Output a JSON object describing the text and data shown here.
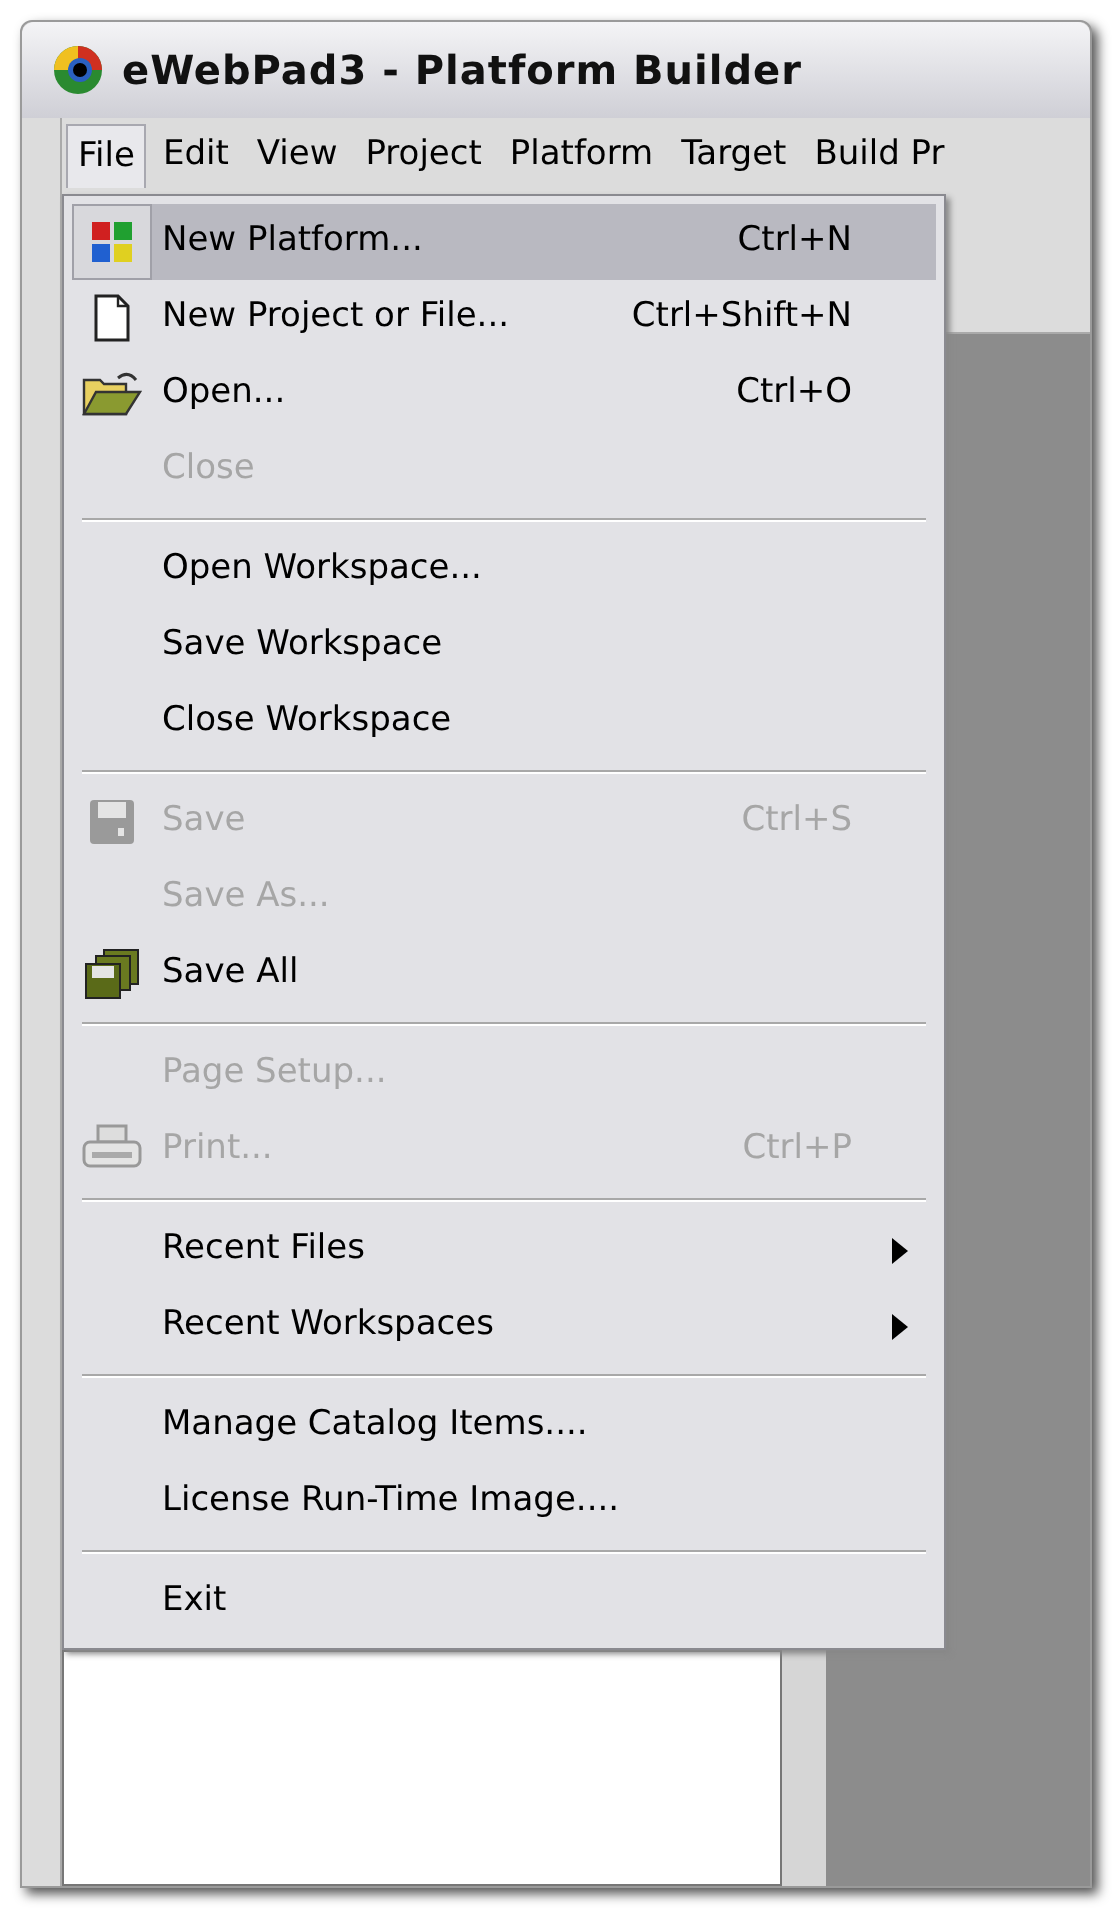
{
  "window": {
    "title": "eWebPad3 - Platform Builder"
  },
  "menu_bar": [
    {
      "label": "File",
      "selected": true
    },
    {
      "label": "Edit",
      "selected": false
    },
    {
      "label": "View",
      "selected": false
    },
    {
      "label": "Project",
      "selected": false
    },
    {
      "label": "Platform",
      "selected": false
    },
    {
      "label": "Target",
      "selected": false
    },
    {
      "label": "Build Pr",
      "selected": false
    }
  ],
  "file_menu": {
    "items": [
      {
        "kind": "item",
        "label": "New Platform...",
        "shortcut": "Ctrl+N",
        "disabled": false,
        "selected": true
      },
      {
        "kind": "item",
        "label": "New Project or File...",
        "shortcut": "Ctrl+Shift+N",
        "disabled": false,
        "selected": false
      },
      {
        "kind": "item",
        "label": "Open...",
        "shortcut": "Ctrl+O",
        "disabled": false,
        "selected": false
      },
      {
        "kind": "item",
        "label": "Close",
        "disabled": true,
        "selected": false
      },
      {
        "kind": "separator"
      },
      {
        "kind": "item",
        "label": "Open Workspace...",
        "disabled": false,
        "selected": false
      },
      {
        "kind": "item",
        "label": "Save Workspace",
        "disabled": false,
        "selected": false
      },
      {
        "kind": "item",
        "label": "Close Workspace",
        "disabled": false,
        "selected": false
      },
      {
        "kind": "separator"
      },
      {
        "kind": "item",
        "label": "Save",
        "shortcut": "Ctrl+S",
        "disabled": true,
        "selected": false
      },
      {
        "kind": "item",
        "label": "Save As...",
        "disabled": true,
        "selected": false
      },
      {
        "kind": "item",
        "label": "Save All",
        "disabled": false,
        "selected": false
      },
      {
        "kind": "separator"
      },
      {
        "kind": "item",
        "label": "Page Setup...",
        "disabled": true,
        "selected": false
      },
      {
        "kind": "item",
        "label": "Print...",
        "shortcut": "Ctrl+P",
        "disabled": true,
        "selected": false
      },
      {
        "kind": "separator"
      },
      {
        "kind": "submenu",
        "label": "Recent Files",
        "disabled": false,
        "selected": false
      },
      {
        "kind": "submenu",
        "label": "Recent Workspaces",
        "disabled": false,
        "selected": false
      },
      {
        "kind": "separator"
      },
      {
        "kind": "item",
        "label": "Manage Catalog Items....",
        "disabled": false,
        "selected": false
      },
      {
        "kind": "item",
        "label": "License Run-Time Image....",
        "disabled": false,
        "selected": false
      },
      {
        "kind": "separator"
      },
      {
        "kind": "item",
        "label": "Exit",
        "disabled": false,
        "selected": false
      }
    ]
  }
}
